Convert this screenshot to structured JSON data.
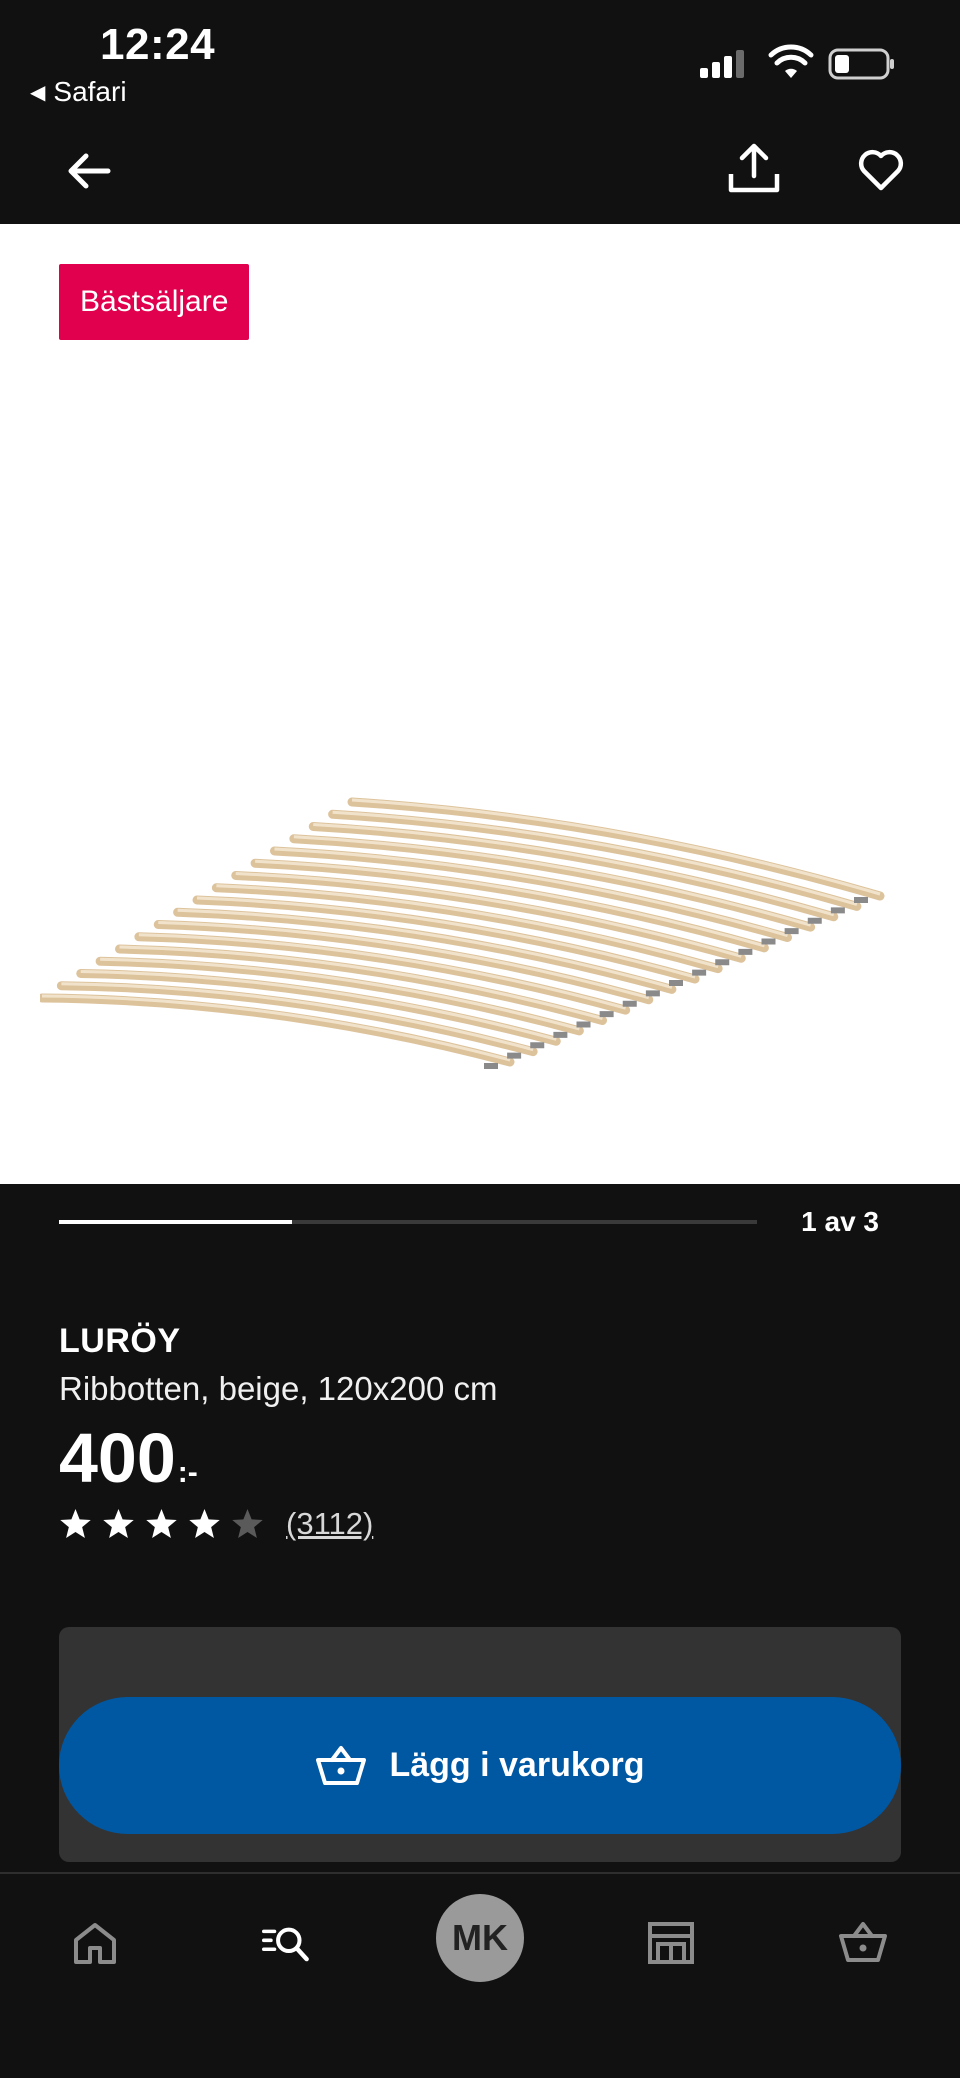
{
  "status_bar": {
    "time": "12:24",
    "back_app": "Safari",
    "back_glyph": "◀"
  },
  "product": {
    "badge": "Bästsäljare",
    "name": "LURÖY",
    "description": "Ribbotten, beige, 120x200 cm",
    "price_value": "400",
    "price_suffix": ":-",
    "rating_stars": 4,
    "rating_max": 5,
    "review_count": "(3112)"
  },
  "carousel": {
    "pager": "1 av 3",
    "current": 1,
    "total": 3
  },
  "cart": {
    "add_label": "Lägg i varukorg"
  },
  "tab_bar": {
    "avatar_initials": "MK",
    "items": [
      "home-icon",
      "search-icon",
      "profile-avatar",
      "store-icon",
      "basket-icon"
    ]
  },
  "colors": {
    "background": "#111111",
    "badge": "#e0004d",
    "cart_button": "#0058a3",
    "cart_panel": "#333333",
    "avatar": "#9a9a9a"
  }
}
